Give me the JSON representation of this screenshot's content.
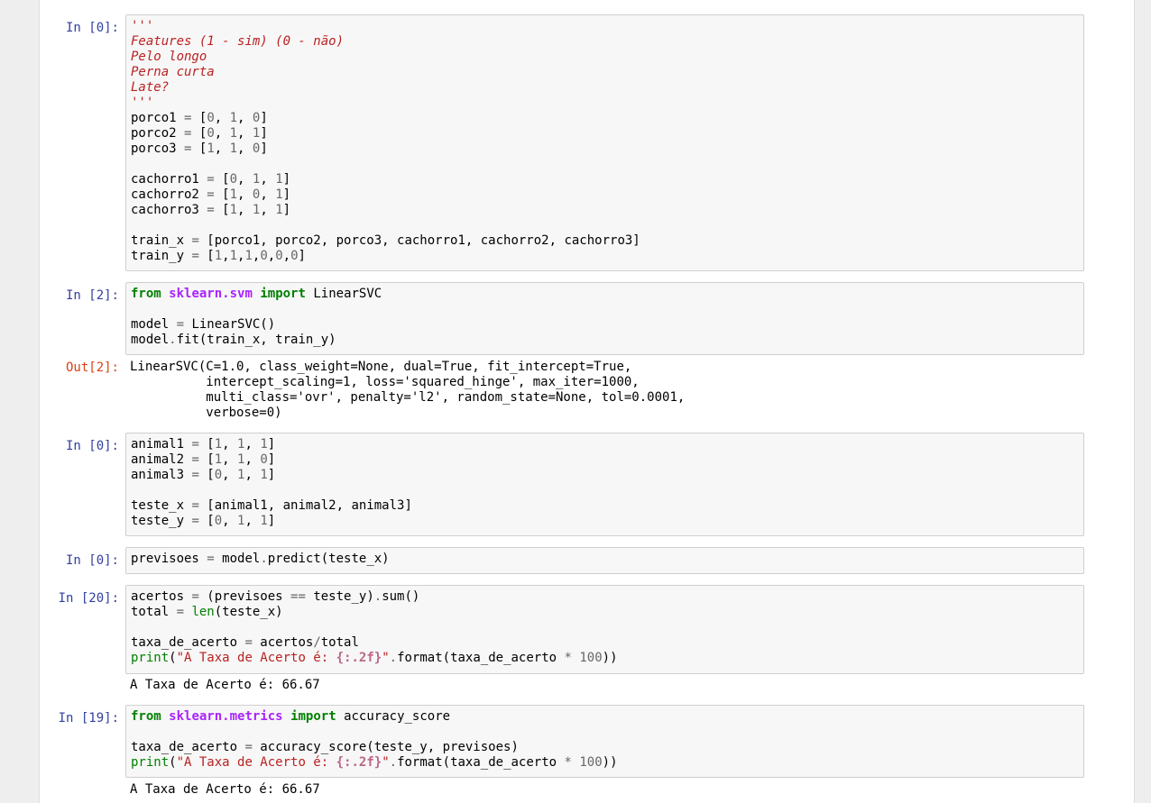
{
  "cells": [
    {
      "prompt": "In [0]:",
      "code": "'''\nFeatures (1 - sim) (0 - não)\nPelo longo\nPerna curta\nLate?\n'''\nporco1 = [0, 1, 0]\nporco2 = [0, 1, 1]\nporco3 = [1, 1, 0]\n\ncachorro1 = [0, 1, 1]\ncachorro2 = [1, 0, 1]\ncachorro3 = [1, 1, 1]\n\ntrain_x = [porco1, porco2, porco3, cachorro1, cachorro2, cachorro3]\ntrain_y = [1,1,1,0,0,0]"
    },
    {
      "prompt": "In [2]:",
      "code": "from sklearn.svm import LinearSVC\n\nmodel = LinearSVC()\nmodel.fit(train_x, train_y)",
      "out_prompt": "Out[2]:",
      "output": "LinearSVC(C=1.0, class_weight=None, dual=True, fit_intercept=True,\n          intercept_scaling=1, loss='squared_hinge', max_iter=1000,\n          multi_class='ovr', penalty='l2', random_state=None, tol=0.0001,\n          verbose=0)"
    },
    {
      "prompt": "In [0]:",
      "code": "animal1 = [1, 1, 1]\nanimal2 = [1, 1, 0]\nanimal3 = [0, 1, 1]\n\nteste_x = [animal1, animal2, animal3]\nteste_y = [0, 1, 1]"
    },
    {
      "prompt": "In [0]:",
      "code": "previsoes = model.predict(teste_x)"
    },
    {
      "prompt": "In [20]:",
      "code": "acertos = (previsoes == teste_y).sum()\ntotal = len(teste_x)\n\ntaxa_de_acerto = acertos/total\nprint(\"A Taxa de Acerto é: {:.2f}\".format(taxa_de_acerto * 100))",
      "output": "A Taxa de Acerto é: 66.67"
    },
    {
      "prompt": "In [19]:",
      "code": "from sklearn.metrics import accuracy_score\n\ntaxa_de_acerto = accuracy_score(teste_y, previsoes)\nprint(\"A Taxa de Acerto é: {:.2f}\".format(taxa_de_acerto * 100))",
      "output": "A Taxa de Acerto é: 66.67"
    }
  ]
}
